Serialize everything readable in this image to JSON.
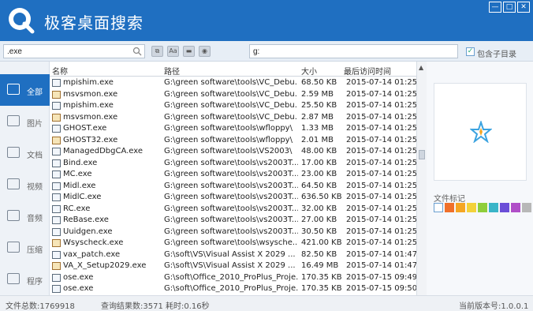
{
  "app": {
    "title": "极客桌面搜索"
  },
  "window_controls": {
    "minimize": "—",
    "maximize": "□",
    "close": "✕"
  },
  "search": {
    "name_value": ".exe",
    "path_value": "g:",
    "include_subdirs_label": "包含子目录",
    "include_subdirs_checked": true
  },
  "toolbar": {
    "btn2_label": "Aa"
  },
  "sidebar": {
    "items": [
      {
        "label": "全部",
        "icon": "all-files-icon",
        "active": true
      },
      {
        "label": "图片",
        "icon": "image-icon",
        "active": false
      },
      {
        "label": "文档",
        "icon": "document-icon",
        "active": false
      },
      {
        "label": "视频",
        "icon": "video-icon",
        "active": false
      },
      {
        "label": "音频",
        "icon": "audio-icon",
        "active": false
      },
      {
        "label": "压缩",
        "icon": "archive-icon",
        "active": false
      },
      {
        "label": "程序",
        "icon": "program-icon",
        "active": false
      }
    ]
  },
  "table": {
    "columns": [
      "名称",
      "路径",
      "大小",
      "最后访问时间"
    ],
    "rows": [
      [
        "mpishim.exe",
        "G:\\green software\\tools\\VC_Debu...",
        "68.50 KB",
        "2015-07-14 01:25"
      ],
      [
        "msvsmon.exe",
        "G:\\green software\\tools\\VC_Debu...",
        "2.59 MB",
        "2015-07-14 01:25"
      ],
      [
        "mpishim.exe",
        "G:\\green software\\tools\\VC_Debu...",
        "25.50 KB",
        "2015-07-14 01:25"
      ],
      [
        "msvsmon.exe",
        "G:\\green software\\tools\\VC_Debu...",
        "2.87 MB",
        "2015-07-14 01:25"
      ],
      [
        "GHOST.exe",
        "G:\\green software\\tools\\wfloppy\\",
        "1.33 MB",
        "2015-07-14 01:25"
      ],
      [
        "GHOST32.exe",
        "G:\\green software\\tools\\wfloppy\\",
        "2.01 MB",
        "2015-07-14 01:25"
      ],
      [
        "ManagedDbgCA.exe",
        "G:\\green software\\tools\\VS2003\\",
        "48.00 KB",
        "2015-07-14 01:25"
      ],
      [
        "Bind.exe",
        "G:\\green software\\tools\\vs2003T...",
        "17.00 KB",
        "2015-07-14 01:25"
      ],
      [
        "MC.exe",
        "G:\\green software\\tools\\vs2003T...",
        "23.00 KB",
        "2015-07-14 01:25"
      ],
      [
        "Midl.exe",
        "G:\\green software\\tools\\vs2003T...",
        "64.50 KB",
        "2015-07-14 01:25"
      ],
      [
        "MidlC.exe",
        "G:\\green software\\tools\\vs2003T...",
        "636.50 KB",
        "2015-07-14 01:25"
      ],
      [
        "RC.exe",
        "G:\\green software\\tools\\vs2003T...",
        "32.00 KB",
        "2015-07-14 01:25"
      ],
      [
        "ReBase.exe",
        "G:\\green software\\tools\\vs2003T...",
        "27.00 KB",
        "2015-07-14 01:25"
      ],
      [
        "Uuidgen.exe",
        "G:\\green software\\tools\\vs2003T...",
        "30.50 KB",
        "2015-07-14 01:25"
      ],
      [
        "Wsyscheck.exe",
        "G:\\green software\\tools\\wsysche...",
        "421.00 KB",
        "2015-07-14 01:25"
      ],
      [
        "vax_patch.exe",
        "G:\\soft\\VS\\Visual Assist X 2029 ...",
        "82.50 KB",
        "2015-07-14 01:47"
      ],
      [
        "VA_X_Setup2029.exe",
        "G:\\soft\\VS\\Visual Assist X 2029 ...",
        "16.49 MB",
        "2015-07-14 01:47"
      ],
      [
        "ose.exe",
        "G:\\soft\\Office_2010_ProPlus_Proje...",
        "170.35 KB",
        "2015-07-15 09:49"
      ],
      [
        "ose.exe",
        "G:\\soft\\Office_2010_ProPlus_Proje...",
        "170.35 KB",
        "2015-07-15 09:50"
      ]
    ]
  },
  "preview": {
    "tags_label": "文件标记",
    "tag_colors": [
      "#ffffff",
      "#f0702a",
      "#f5a623",
      "#f3d23a",
      "#8fce3a",
      "#3ab5c8",
      "#6b4fd8",
      "#b04fc8",
      "#b8b8b8"
    ]
  },
  "status": {
    "total_files": "文件总数:1769918",
    "query_results": "查询结果数:3571 耗时:0.16秒",
    "version": "当前版本号:1.0.0.1"
  },
  "colors": {
    "brand": "#1f6fc1"
  }
}
